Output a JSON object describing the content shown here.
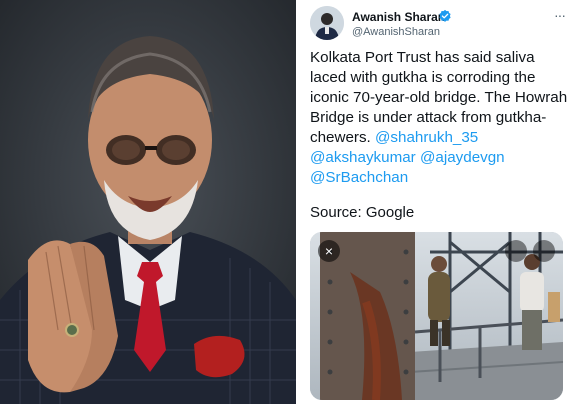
{
  "tweet": {
    "author": {
      "name": "Awanish Sharan",
      "handle": "@AwanishSharan",
      "verified": true,
      "avatar_icon": "avatar-person-icon"
    },
    "more_icon": "more-horizontal-icon",
    "text_line": "Kolkata Port Trust has said saliva laced with gutkha is corroding the iconic 70-year-old bridge. The Howrah Bridge is under attack from gutkha-chewers.",
    "mentions": [
      "@shahrukh_35",
      "@akshaykumar",
      "@ajaydevgn",
      "@SrBachchan"
    ],
    "source_text": "Source: Google",
    "media": {
      "close_glyph": "×",
      "close_icon": "close-icon"
    }
  },
  "colors": {
    "link": "#1d9bf0",
    "verified": "#1d9bf0",
    "text": "#0f1419",
    "secondary": "#536471"
  }
}
